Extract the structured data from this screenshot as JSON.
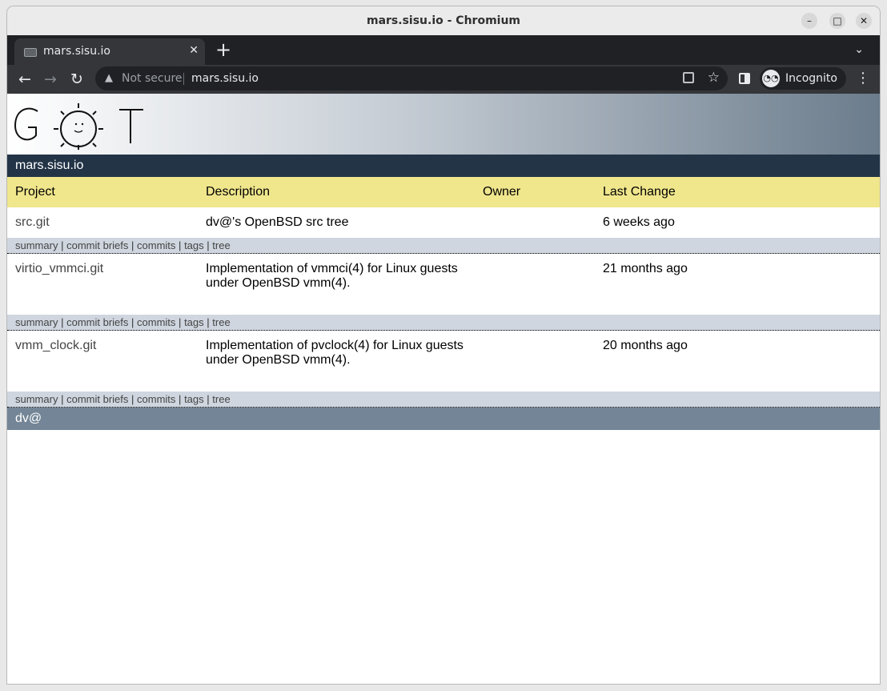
{
  "window": {
    "title": "mars.sisu.io - Chromium"
  },
  "tab": {
    "title": "mars.sisu.io"
  },
  "omnibox": {
    "security": "Not secure",
    "url": "mars.sisu.io"
  },
  "profile": {
    "label": "Incognito"
  },
  "site": {
    "logo_text": "GOT",
    "name": "mars.sisu.io",
    "columns": {
      "project": "Project",
      "description": "Description",
      "owner": "Owner",
      "last_change": "Last Change"
    },
    "repos": [
      {
        "project": "src.git",
        "description": "dv@'s OpenBSD src tree",
        "owner": "",
        "last_change": "6 weeks ago"
      },
      {
        "project": "virtio_vmmci.git",
        "description": "Implementation of vmmci(4) for Linux guests under OpenBSD vmm(4).",
        "owner": "",
        "last_change": "21 months ago"
      },
      {
        "project": "vmm_clock.git",
        "description": "Implementation of pvclock(4) for Linux guests under OpenBSD vmm(4).",
        "owner": "",
        "last_change": "20 months ago"
      }
    ],
    "links": {
      "summary": "summary",
      "commit_briefs": "commit briefs",
      "commits": "commits",
      "tags": "tags",
      "tree": "tree",
      "separator": "|"
    },
    "footer": "dv@"
  },
  "icons": {
    "back": "back-arrow-icon",
    "forward": "forward-arrow-icon",
    "reload": "reload-icon",
    "star": "star-icon",
    "incognito": "incognito-icon"
  }
}
